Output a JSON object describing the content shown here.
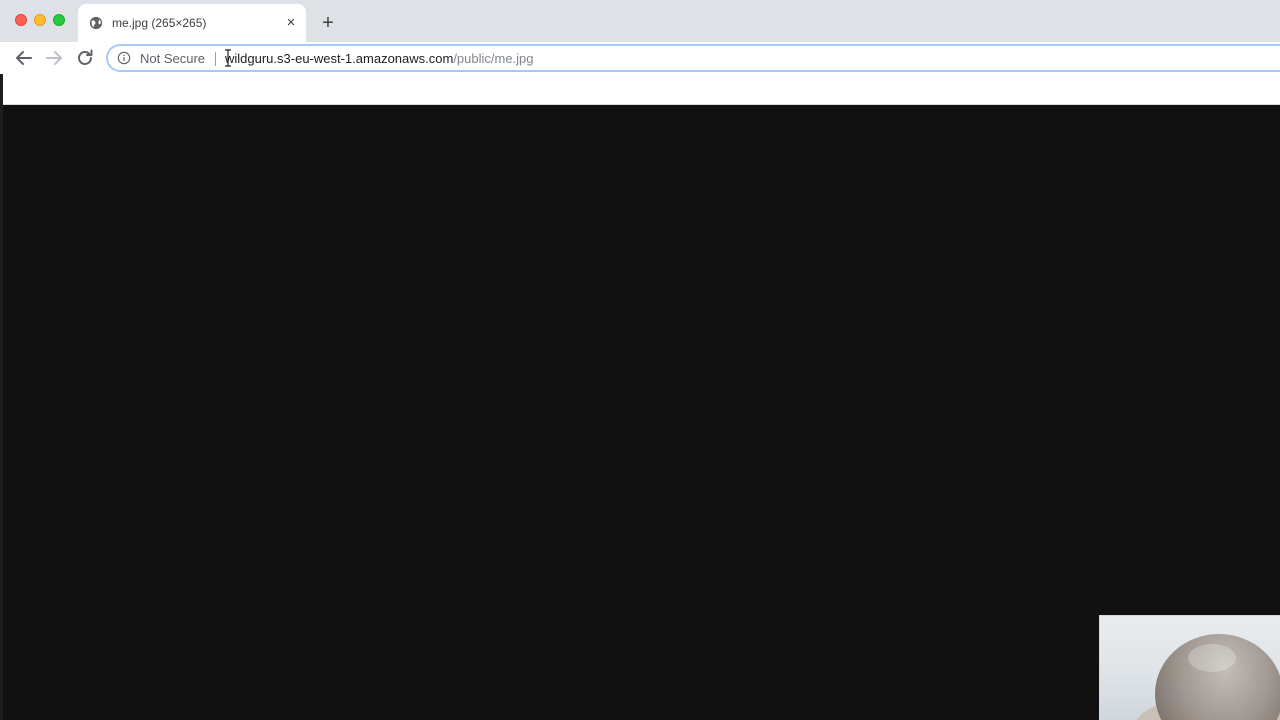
{
  "window": {
    "controls": [
      "close",
      "minimize",
      "zoom"
    ]
  },
  "tab": {
    "title": "me.jpg (265×265)",
    "favicon": "globe-icon",
    "close_glyph": "×"
  },
  "new_tab_glyph": "+",
  "toolbar": {
    "back_icon": "arrow-left-icon",
    "forward_icon": "arrow-right-icon",
    "reload_icon": "reload-icon"
  },
  "omnibox": {
    "security_label": "Not Secure",
    "url_host": "wildguru.s3-eu-west-1.amazonaws.com",
    "url_path": "/public/me.jpg"
  },
  "colors": {
    "tabstrip": "#dee1e6",
    "content_bg": "#111111",
    "omnibox_focus": "#a8c7fa"
  }
}
